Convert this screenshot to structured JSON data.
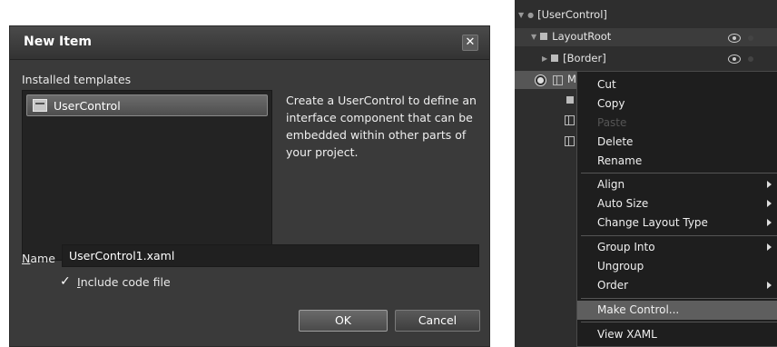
{
  "dialog": {
    "title": "New Item",
    "close_glyph": "✕",
    "installed_templates_label": "Installed templates",
    "templates": [
      {
        "label": "UserControl",
        "icon": "usercontrol-icon"
      }
    ],
    "description": "Create a UserControl to define an interface component that can be embedded within other parts of your project.",
    "name_label_mnemonic": "N",
    "name_label_rest": "ame",
    "name_value": "UserControl1.xaml",
    "include_code_checked": true,
    "include_code_mnemonic": "I",
    "include_code_rest": "nclude code file",
    "ok_label": "OK",
    "cancel_label": "Cancel"
  },
  "tree": {
    "rows": [
      {
        "label": "[UserControl]"
      },
      {
        "label": "LayoutRoot"
      },
      {
        "label": "[Border]"
      },
      {
        "label": "M"
      }
    ]
  },
  "context_menu": {
    "items": [
      {
        "label": "Cut",
        "enabled": true,
        "submenu": false
      },
      {
        "label": "Copy",
        "enabled": true,
        "submenu": false
      },
      {
        "label": "Paste",
        "enabled": false,
        "submenu": false
      },
      {
        "label": "Delete",
        "enabled": true,
        "submenu": false
      },
      {
        "label": "Rename",
        "enabled": true,
        "submenu": false
      },
      {
        "label": "Align",
        "enabled": true,
        "submenu": true
      },
      {
        "label": "Auto Size",
        "enabled": true,
        "submenu": true
      },
      {
        "label": "Change Layout Type",
        "enabled": true,
        "submenu": true
      },
      {
        "label": "Group Into",
        "enabled": true,
        "submenu": true
      },
      {
        "label": "Ungroup",
        "enabled": true,
        "submenu": false
      },
      {
        "label": "Order",
        "enabled": true,
        "submenu": true
      },
      {
        "label": "Make Control...",
        "enabled": true,
        "submenu": false,
        "highlighted": true
      },
      {
        "label": "View XAML",
        "enabled": true,
        "submenu": false
      }
    ]
  }
}
